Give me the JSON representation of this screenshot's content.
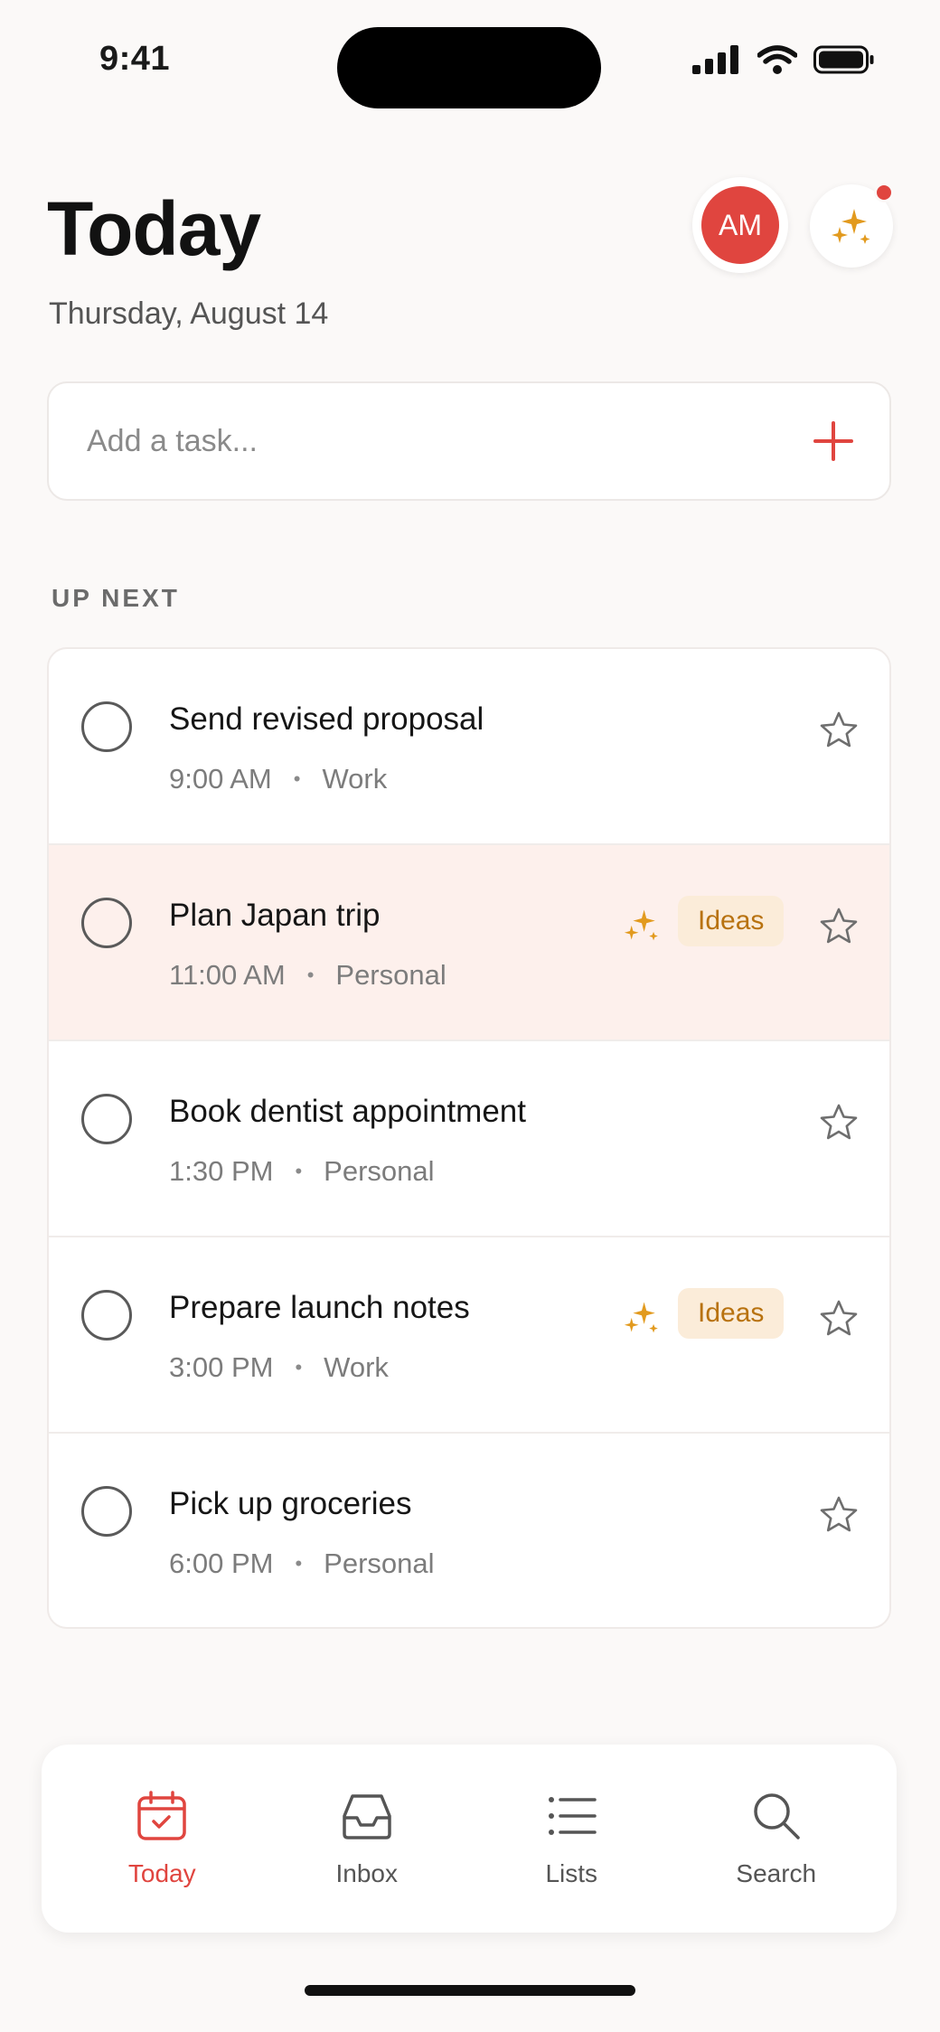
{
  "status_bar": {
    "time": "9:41"
  },
  "header": {
    "title": "Today",
    "date": "Thursday, August 14",
    "avatar_initials": "AM"
  },
  "add_task": {
    "placeholder": "Add a task..."
  },
  "section": {
    "label": "UP NEXT"
  },
  "tasks": [
    {
      "title": "Send revised proposal",
      "time": "9:00 AM",
      "category": "Work",
      "tag": "",
      "highlighted": false
    },
    {
      "title": "Plan Japan trip",
      "time": "11:00 AM",
      "category": "Personal",
      "tag": "Ideas",
      "highlighted": true
    },
    {
      "title": "Book dentist appointment",
      "time": "1:30 PM",
      "category": "Personal",
      "tag": "",
      "highlighted": false
    },
    {
      "title": "Prepare launch notes",
      "time": "3:00 PM",
      "category": "Work",
      "tag": "Ideas",
      "highlighted": false
    },
    {
      "title": "Pick up groceries",
      "time": "6:00 PM",
      "category": "Personal",
      "tag": "",
      "highlighted": false
    }
  ],
  "nav": {
    "items": [
      {
        "label": "Today",
        "icon": "calendar-icon",
        "active": true
      },
      {
        "label": "Inbox",
        "icon": "inbox-icon",
        "active": false
      },
      {
        "label": "Lists",
        "icon": "list-icon",
        "active": false
      },
      {
        "label": "Search",
        "icon": "search-icon",
        "active": false
      }
    ]
  },
  "colors": {
    "accent": "#e0453f",
    "ideas_tag_bg": "#fbecd9",
    "ideas_tag_text": "#b8720f",
    "sparkle": "#e29a1e",
    "highlight_row": "#fdf0ec"
  }
}
